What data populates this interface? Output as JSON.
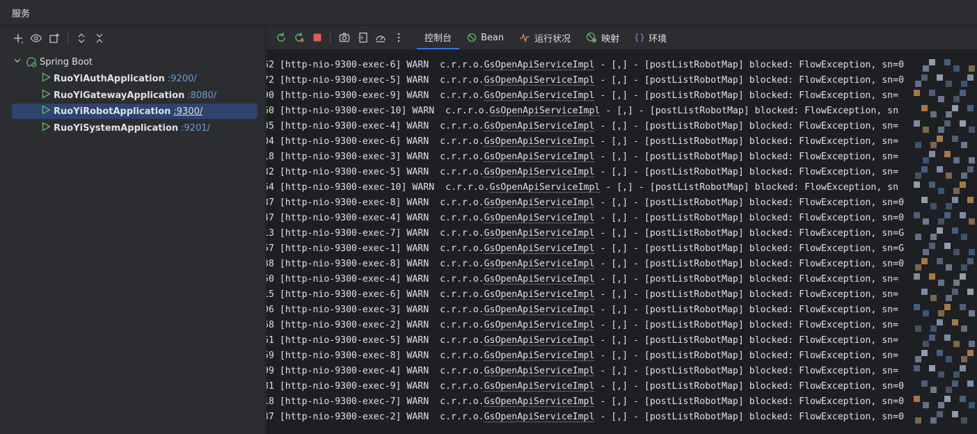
{
  "header": {
    "title": "服务"
  },
  "sidebar": {
    "toolbar": [
      {
        "icon": "add-icon"
      },
      {
        "icon": "eye-icon"
      },
      {
        "icon": "new-group-icon"
      },
      {
        "icon": "expand-all-icon"
      },
      {
        "icon": "collapse-all-icon"
      }
    ],
    "root": {
      "label": "Spring Boot",
      "icon": "spring-boot-icon"
    },
    "apps": [
      {
        "name": "RuoYiAuthApplication",
        "port": ":9200/",
        "selected": false
      },
      {
        "name": "RuoYiGatewayApplication",
        "port": ":8080/",
        "selected": false
      },
      {
        "name": "RuoYiRobotApplication",
        "port": ":9300/",
        "selected": true
      },
      {
        "name": "RuoYiSystemApplication",
        "port": ":9201/",
        "selected": false
      }
    ]
  },
  "toolbar": {
    "actions": [
      {
        "icon": "rerun-icon"
      },
      {
        "icon": "rerun-failed-icon"
      },
      {
        "icon": "stop-icon"
      },
      {
        "icon": "camera-icon"
      },
      {
        "icon": "exit-icon"
      },
      {
        "icon": "gauge-icon"
      },
      {
        "icon": "more-icon"
      }
    ],
    "tabs": [
      {
        "label": "控制台",
        "icon": "",
        "active": true
      },
      {
        "label": "Bean",
        "icon": "bean-icon",
        "active": false
      },
      {
        "label": "运行状况",
        "icon": "health-icon",
        "active": false
      },
      {
        "label": "映射",
        "icon": "mappings-icon",
        "active": false
      },
      {
        "label": "环境",
        "icon": "environment-icon",
        "active": false
      }
    ]
  },
  "console": {
    "lines": [
      {
        "pre": "62 [http-nio-9300-exec-6] WARN  c.r.r.o.",
        "cls": "GsOpenApiServiceImpl",
        "post": " - [,] - [postListRobotMap] blocked: FlowException, sn=0"
      },
      {
        "pre": "72 [http-nio-9300-exec-5] WARN  c.r.r.o.",
        "cls": "GsOpenApiServiceImpl",
        "post": " - [,] - [postListRobotMap] blocked: FlowException, sn=0"
      },
      {
        "pre": "90 [http-nio-9300-exec-9] WARN  c.r.r.o.",
        "cls": "GsOpenApiServiceImpl",
        "post": " - [,] - [postListRobotMap] blocked: FlowException, sn="
      },
      {
        "pre": "60 [http-nio-9300-exec-10] WARN  c.r.r.o.",
        "cls": "GsOpenApiServiceImpl",
        "post": " - [,] - [postListRobotMap] blocked: FlowException, sn"
      },
      {
        "pre": "35 [http-nio-9300-exec-4] WARN  c.r.r.o.",
        "cls": "GsOpenApiServiceImpl",
        "post": " - [,] - [postListRobotMap] blocked: FlowException, sn="
      },
      {
        "pre": "04 [http-nio-9300-exec-6] WARN  c.r.r.o.",
        "cls": "GsOpenApiServiceImpl",
        "post": " - [,] - [postListRobotMap] blocked: FlowException, sn="
      },
      {
        "pre": "18 [http-nio-9300-exec-3] WARN  c.r.r.o.",
        "cls": "GsOpenApiServiceImpl",
        "post": " - [,] - [postListRobotMap] blocked: FlowException, sn="
      },
      {
        "pre": "32 [http-nio-9300-exec-5] WARN  c.r.r.o.",
        "cls": "GsOpenApiServiceImpl",
        "post": " - [,] - [postListRobotMap] blocked: FlowException, sn="
      },
      {
        "pre": "64 [http-nio-9300-exec-10] WARN  c.r.r.o.",
        "cls": "GsOpenApiServiceImpl",
        "post": " - [,] - [postListRobotMap] blocked: FlowException, sn"
      },
      {
        "pre": "37 [http-nio-9300-exec-8] WARN  c.r.r.o.",
        "cls": "GsOpenApiServiceImpl",
        "post": " - [,] - [postListRobotMap] blocked: FlowException, sn=0"
      },
      {
        "pre": "47 [http-nio-9300-exec-4] WARN  c.r.r.o.",
        "cls": "GsOpenApiServiceImpl",
        "post": " - [,] - [postListRobotMap] blocked: FlowException, sn=0"
      },
      {
        "pre": "13 [http-nio-9300-exec-7] WARN  c.r.r.o.",
        "cls": "GsOpenApiServiceImpl",
        "post": " - [,] - [postListRobotMap] blocked: FlowException, sn=G"
      },
      {
        "pre": "57 [http-nio-9300-exec-1] WARN  c.r.r.o.",
        "cls": "GsOpenApiServiceImpl",
        "post": " - [,] - [postListRobotMap] blocked: FlowException, sn=G"
      },
      {
        "pre": "38 [http-nio-9300-exec-8] WARN  c.r.r.o.",
        "cls": "GsOpenApiServiceImpl",
        "post": " - [,] - [postListRobotMap] blocked: FlowException, sn=0"
      },
      {
        "pre": "50 [http-nio-9300-exec-4] WARN  c.r.r.o.",
        "cls": "GsOpenApiServiceImpl",
        "post": " - [,] - [postListRobotMap] blocked: FlowException, sn="
      },
      {
        "pre": "15 [http-nio-9300-exec-6] WARN  c.r.r.o.",
        "cls": "GsOpenApiServiceImpl",
        "post": " - [,] - [postListRobotMap] blocked: FlowException, sn="
      },
      {
        "pre": "06 [http-nio-9300-exec-3] WARN  c.r.r.o.",
        "cls": "GsOpenApiServiceImpl",
        "post": " - [,] - [postListRobotMap] blocked: FlowException, sn="
      },
      {
        "pre": "68 [http-nio-9300-exec-2] WARN  c.r.r.o.",
        "cls": "GsOpenApiServiceImpl",
        "post": " - [,] - [postListRobotMap] blocked: FlowException, sn="
      },
      {
        "pre": "61 [http-nio-9300-exec-5] WARN  c.r.r.o.",
        "cls": "GsOpenApiServiceImpl",
        "post": " - [,] - [postListRobotMap] blocked: FlowException, sn="
      },
      {
        "pre": "59 [http-nio-9300-exec-8] WARN  c.r.r.o.",
        "cls": "GsOpenApiServiceImpl",
        "post": " - [,] - [postListRobotMap] blocked: FlowException, sn="
      },
      {
        "pre": "99 [http-nio-9300-exec-4] WARN  c.r.r.o.",
        "cls": "GsOpenApiServiceImpl",
        "post": " - [,] - [postListRobotMap] blocked: FlowException, sn="
      },
      {
        "pre": "81 [http-nio-9300-exec-9] WARN  c.r.r.o.",
        "cls": "GsOpenApiServiceImpl",
        "post": " - [,] - [postListRobotMap] blocked: FlowException, sn=0"
      },
      {
        "pre": "18 [http-nio-9300-exec-7] WARN  c.r.r.o.",
        "cls": "GsOpenApiServiceImpl",
        "post": " - [,] - [postListRobotMap] blocked: FlowException, sn=0"
      },
      {
        "pre": "37 [http-nio-9300-exec-2] WARN  c.r.r.o.",
        "cls": "GsOpenApiServiceImpl",
        "post": " - [,] - [postListRobotMap] blocked: FlowException, sn=0"
      }
    ]
  },
  "colors": {
    "accent": "#3574f0",
    "run_green": "#5fb865",
    "stop_red": "#db5c5c",
    "port_blue": "#6d9dd8",
    "selection": "#2e436e"
  }
}
